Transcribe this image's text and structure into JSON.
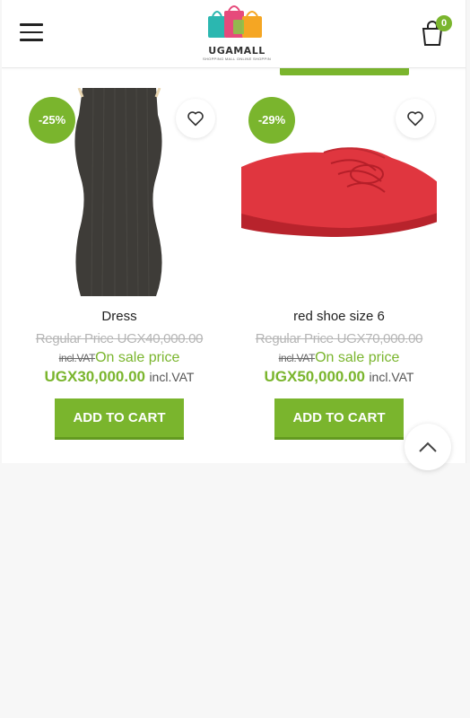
{
  "header": {
    "menu_icon": "hamburger-menu-icon",
    "logo_text": "UGAMALL",
    "logo_tagline": "SHOPPING MALL ONLINE SHOPPING",
    "cart_icon": "shopping-bag-icon",
    "cart_count": "0"
  },
  "products": [
    {
      "badge": "-25%",
      "title": "Dress",
      "regular_price": "Regular Price UGX40,000.00",
      "incl_strike": "incl.VAT",
      "on_sale_label": "On sale price",
      "sale_price": "UGX30,000.00",
      "incl_vat": "incl.VAT",
      "button_label": "ADD TO CART",
      "wishlist_icon": "heart-icon"
    },
    {
      "badge": "-29%",
      "title": "red shoe size 6",
      "regular_price": "Regular Price UGX70,000.00",
      "incl_strike": "incl.VAT",
      "on_sale_label": "On sale price",
      "sale_price": "UGX50,000.00",
      "incl_vat": "incl.VAT",
      "button_label": "ADD TO CART",
      "wishlist_icon": "heart-icon"
    }
  ],
  "scroll_top_icon": "chevron-up-icon",
  "colors": {
    "accent": "#7ab52d",
    "strike_text": "#b5b5b5"
  }
}
